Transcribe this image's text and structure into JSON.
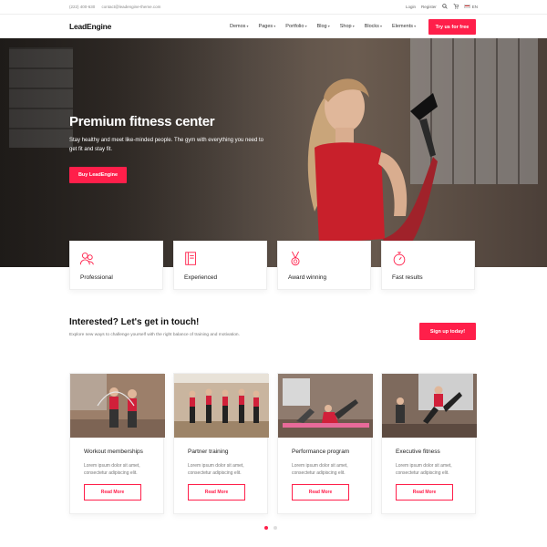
{
  "topbar": {
    "phone": "(222) 400-630",
    "email": "contact@leadengine-theme.com",
    "login": "Login",
    "register": "Register",
    "language": "EN"
  },
  "nav": {
    "logo": "LeadEngine",
    "items": [
      "Demos",
      "Pages",
      "Portfolio",
      "Blog",
      "Shop",
      "Blocks",
      "Elements"
    ],
    "cta": "Try us for free"
  },
  "hero": {
    "title": "Premium fitness center",
    "text": "Stay healthy and meet like-minded people. The gym with everything you need to get fit and stay fit.",
    "button": "Buy LeadEngine"
  },
  "features": [
    {
      "label": "Professional",
      "icon": "group-icon"
    },
    {
      "label": "Experienced",
      "icon": "book-icon"
    },
    {
      "label": "Award winning",
      "icon": "medal-icon"
    },
    {
      "label": "Fast results",
      "icon": "stopwatch-icon"
    }
  ],
  "contact": {
    "title": "Interested? Let's get in touch!",
    "text": "Explore new ways to challenge yourself with the right balance of training and motivation.",
    "button": "Sign up today!"
  },
  "cards": [
    {
      "title": "Workout memberships",
      "text": "Lorem ipsum dolor sit amet, consectetur adipiscing elit.",
      "button": "Read More"
    },
    {
      "title": "Partner training",
      "text": "Lorem ipsum dolor sit amet, consectetur adipiscing elit.",
      "button": "Read More"
    },
    {
      "title": "Performance program",
      "text": "Lorem ipsum dolor sit amet, consectetur adipiscing elit.",
      "button": "Read More"
    },
    {
      "title": "Executive fitness",
      "text": "Lorem ipsum dolor sit amet, consectetur adipiscing elit.",
      "button": "Read More"
    }
  ],
  "pagination": {
    "pages": 2,
    "active": 1
  },
  "colors": {
    "accent": "#ff1f4a"
  }
}
